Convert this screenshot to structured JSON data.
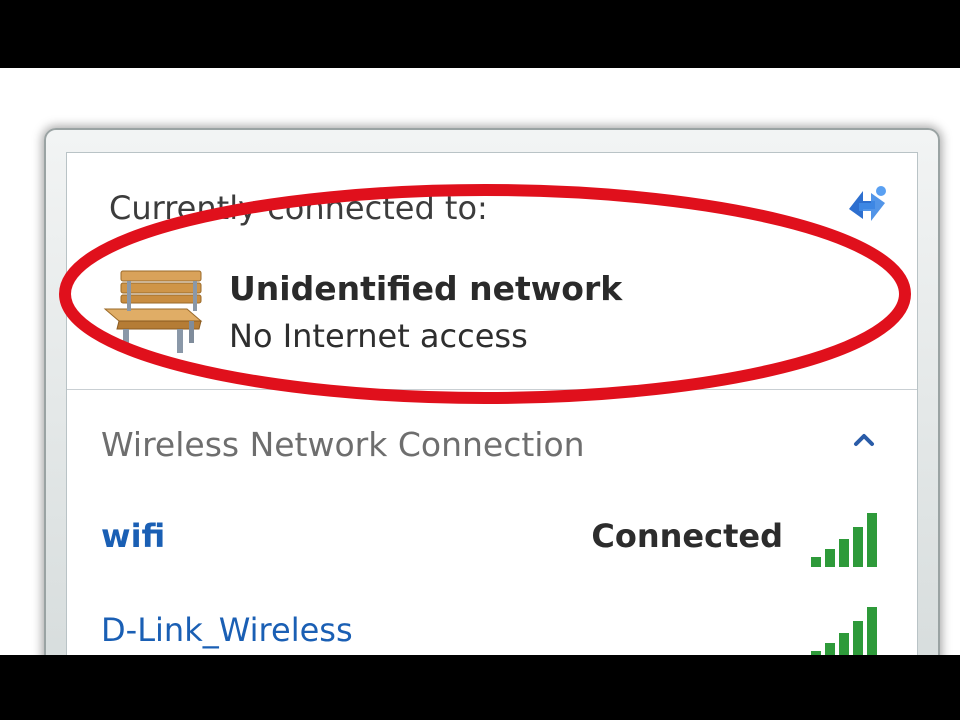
{
  "current": {
    "header": "Currently connected to:",
    "network_name": "Unidentified network",
    "network_status": "No Internet access"
  },
  "wireless": {
    "section_title": "Wireless Network Connection",
    "networks": [
      {
        "ssid": "wifi",
        "status": "Connected",
        "signal_bars": 5
      },
      {
        "ssid": "D-Link_Wireless",
        "status": "",
        "signal_bars": 5
      }
    ]
  },
  "icons": {
    "refresh": "network-refresh-icon",
    "network_type": "bench-icon",
    "collapse": "chevron-up-icon",
    "signal": "signal-strength-icon"
  },
  "colors": {
    "highlight": "#e0101c",
    "link": "#1a5fb4",
    "signal_green": "#2e9a3a"
  }
}
